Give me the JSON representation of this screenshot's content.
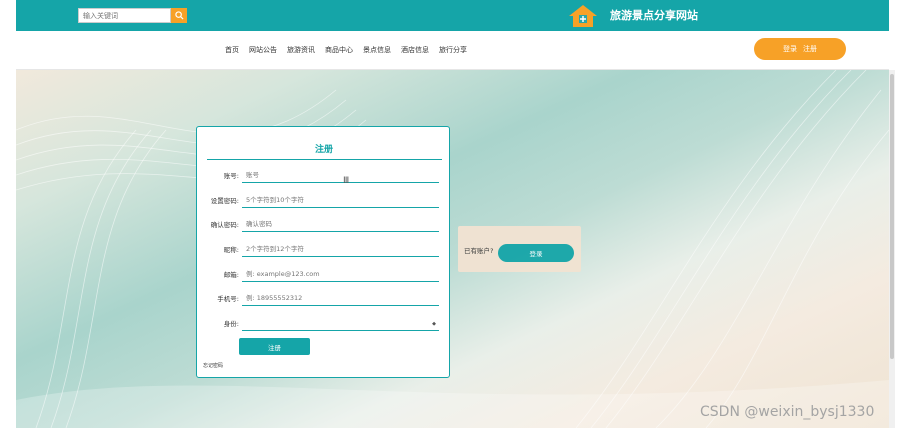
{
  "header": {
    "search": {
      "placeholder": "输入关键词"
    },
    "site_title": "旅游景点分享网站"
  },
  "nav": {
    "items": [
      "首页",
      "网站公告",
      "旅游资讯",
      "商品中心",
      "景点信息",
      "酒店信息",
      "旅行分享"
    ],
    "login_label": "登录",
    "register_label": "注册"
  },
  "register_form": {
    "title": "注册",
    "fields": [
      {
        "label": "账号:",
        "placeholder": "账号"
      },
      {
        "label": "设置密码:",
        "placeholder": "5个字符到10个字符"
      },
      {
        "label": "确认密码:",
        "placeholder": "确认密码"
      },
      {
        "label": "昵称:",
        "placeholder": "2个字符到12个字符"
      },
      {
        "label": "邮箱:",
        "placeholder": "例: example@123.com"
      },
      {
        "label": "手机号:",
        "placeholder": "例: 18955552312"
      },
      {
        "label": "身份:",
        "value": ""
      }
    ],
    "submit_label": "注册",
    "forgot_label": "忘记密码"
  },
  "login_prompt": {
    "text": "已有账户?",
    "button_label": "登录"
  },
  "watermark": "CSDN @weixin_bysj1330",
  "colors": {
    "accent": "#15a5a8",
    "orange": "#f7a127"
  },
  "icons": [
    "search-icon",
    "home-logo-icon",
    "chevron-down-icon",
    "text-cursor-icon"
  ]
}
